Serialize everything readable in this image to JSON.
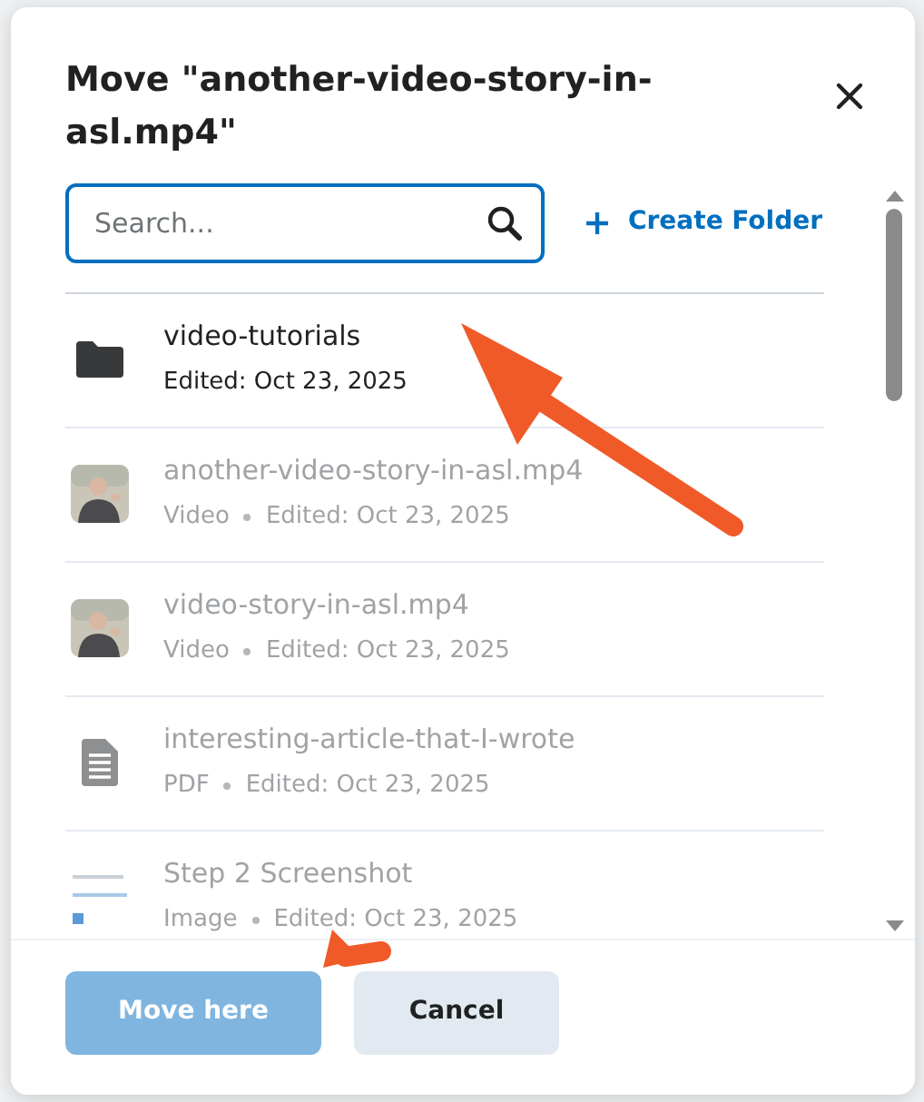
{
  "dialog": {
    "title": "Move \"another-video-story-in-asl.mp4\"",
    "search": {
      "placeholder": "Search..."
    },
    "create_folder": "Create Folder",
    "items": [
      {
        "kind": "folder",
        "name": "video-tutorials",
        "edited": "Edited: Oct 23, 2025",
        "disabled": false
      },
      {
        "kind": "video",
        "name": "another-video-story-in-asl.mp4",
        "type": "Video",
        "edited": "Edited: Oct 23, 2025",
        "disabled": true
      },
      {
        "kind": "video",
        "name": "video-story-in-asl.mp4",
        "type": "Video",
        "edited": "Edited: Oct 23, 2025",
        "disabled": true
      },
      {
        "kind": "document",
        "name": "interesting-article-that-I-wrote",
        "type": "PDF",
        "edited": "Edited: Oct 23, 2025",
        "disabled": true
      },
      {
        "name": "Step 2 Screenshot",
        "type": "Image",
        "edited": "Edited: Oct 23, 2025",
        "disabled": true
      }
    ],
    "buttons": [
      {
        "kind": "primary",
        "label": "Move here",
        "disabled": true
      },
      {
        "kind": "secondary",
        "label": "Cancel",
        "disabled": false
      }
    ]
  }
}
